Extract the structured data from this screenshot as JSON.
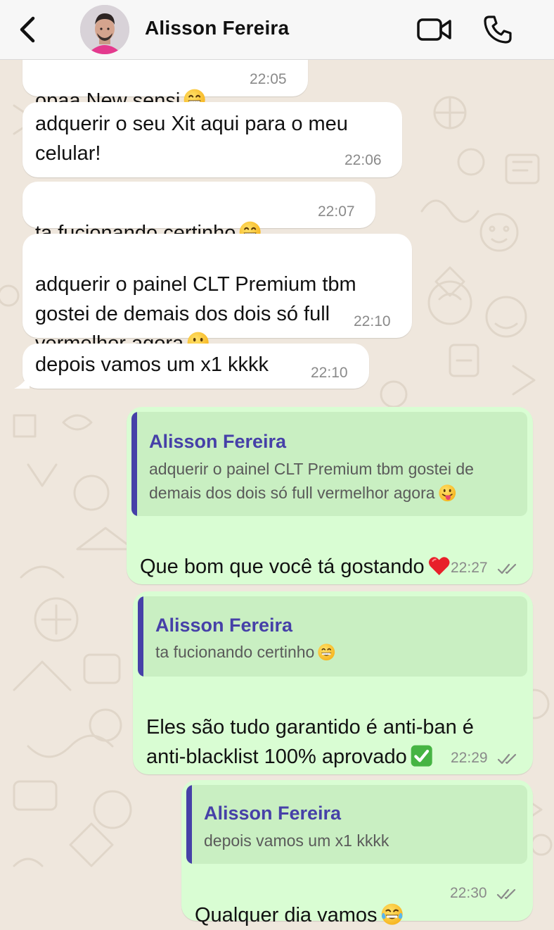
{
  "header": {
    "back_icon": "chevron-left-icon",
    "contact_name": "Alisson Fereira",
    "video_icon": "video-camera-icon",
    "call_icon": "phone-icon"
  },
  "messages": [
    {
      "direction": "incoming",
      "text": "opaa New sensi",
      "emoji": "grinning-face",
      "time": "22:05"
    },
    {
      "direction": "incoming",
      "text": "adquerir o seu Xit aqui para o meu\ncelular!",
      "time": "22:06"
    },
    {
      "direction": "incoming",
      "text": "ta fucionando certinho",
      "emoji": "grinning-face",
      "time": "22:07"
    },
    {
      "direction": "incoming",
      "text": "adquerir o painel CLT Premium tbm\ngostei de demais dos dois só full\nvermelhor agora",
      "emoji": "tongue-face",
      "time": "22:10"
    },
    {
      "direction": "incoming",
      "text": "depois vamos um x1 kkkk",
      "time": "22:10"
    },
    {
      "direction": "outgoing",
      "quote": {
        "author": "Alisson Fereira",
        "text": "adquerir o painel CLT Premium tbm gostei de demais dos dois só full vermelhor agora",
        "emoji": "tongue-face"
      },
      "text": "Que bom que você tá gostando",
      "emoji": "red-heart",
      "time": "22:27",
      "status": "read"
    },
    {
      "direction": "outgoing",
      "quote": {
        "author": "Alisson Fereira",
        "text": "ta fucionando certinho",
        "emoji": "grinning-face"
      },
      "text": "Eles são tudo garantido é anti-ban é\nanti-blacklist 100% aprovado",
      "emoji": "check-mark-button",
      "time": "22:29",
      "status": "read"
    },
    {
      "direction": "outgoing",
      "quote": {
        "author": "Alisson Fereira",
        "text": "depois vamos um x1 kkkk"
      },
      "text": "Qualquer dia vamos",
      "emoji": "tears-of-joy-face",
      "time": "22:30",
      "status": "read"
    }
  ],
  "colors": {
    "chat_background": "#efe7dd",
    "incoming_bubble": "#ffffff",
    "outgoing_bubble": "#d9fdd3",
    "quote_background": "#c9efc2",
    "quote_accent": "#4640a8",
    "timestamp": "#8a8a8a"
  }
}
